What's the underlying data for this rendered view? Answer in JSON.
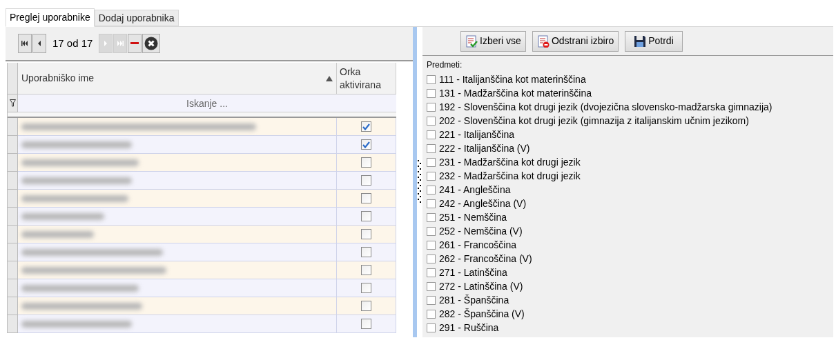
{
  "tabs": [
    {
      "label": "Preglej uporabnike",
      "selected": true
    },
    {
      "label": "Dodaj uporabnika",
      "selected": false
    }
  ],
  "pager": {
    "text": "17 od 17",
    "first_disabled": false,
    "prev_disabled": false,
    "next_disabled": true,
    "last_disabled": true
  },
  "table": {
    "columns": [
      {
        "label": "Uporabniško ime",
        "sorted_ascending": true
      },
      {
        "label": "Orka aktivirana"
      }
    ],
    "filter_placeholder": "Iskanje ...",
    "rows": [
      {
        "checked": true
      },
      {
        "checked": true
      },
      {
        "checked": false
      },
      {
        "checked": false
      },
      {
        "checked": false
      },
      {
        "checked": false
      },
      {
        "checked": false
      },
      {
        "checked": false
      },
      {
        "checked": false
      },
      {
        "checked": false
      },
      {
        "checked": false
      },
      {
        "checked": false
      }
    ]
  },
  "toolbar": [
    {
      "label": "Izberi vse",
      "kind": "select-all"
    },
    {
      "label": "Odstrani izbiro",
      "kind": "remove"
    },
    {
      "label": "Potrdi",
      "kind": "save"
    }
  ],
  "subjects_label": "Predmeti:",
  "subjects": [
    {
      "label": "111 - Italijanščina kot materinščina",
      "checked": false
    },
    {
      "label": "131 - Madžarščina kot materinščina",
      "checked": false
    },
    {
      "label": "192 - Slovenščina kot drugi jezik (dvojezična slovensko-madžarska gimnazija)",
      "checked": false
    },
    {
      "label": "202 - Slovenščina kot drugi jezik (gimnazija z italijanskim učnim jezikom)",
      "checked": false
    },
    {
      "label": "221 - Italijanščina",
      "checked": false
    },
    {
      "label": "222 - Italijanščina (V)",
      "checked": false
    },
    {
      "label": "231 - Madžarščina kot drugi jezik",
      "checked": false
    },
    {
      "label": "232 - Madžarščina kot drugi jezik",
      "checked": false
    },
    {
      "label": "241 - Angleščina",
      "checked": false
    },
    {
      "label": "242 - Angleščina (V)",
      "checked": false
    },
    {
      "label": "251 - Nemščina",
      "checked": false
    },
    {
      "label": "252 - Nemščina (V)",
      "checked": false
    },
    {
      "label": "261 - Francoščina",
      "checked": false
    },
    {
      "label": "262 - Francoščina (V)",
      "checked": false
    },
    {
      "label": "271 - Latinščina",
      "checked": false
    },
    {
      "label": "272 - Latinščina (V)",
      "checked": false
    },
    {
      "label": "281 - Španščina",
      "checked": false
    },
    {
      "label": "282 - Španščina (V)",
      "checked": false
    },
    {
      "label": "291 - Ruščina",
      "checked": false
    }
  ]
}
